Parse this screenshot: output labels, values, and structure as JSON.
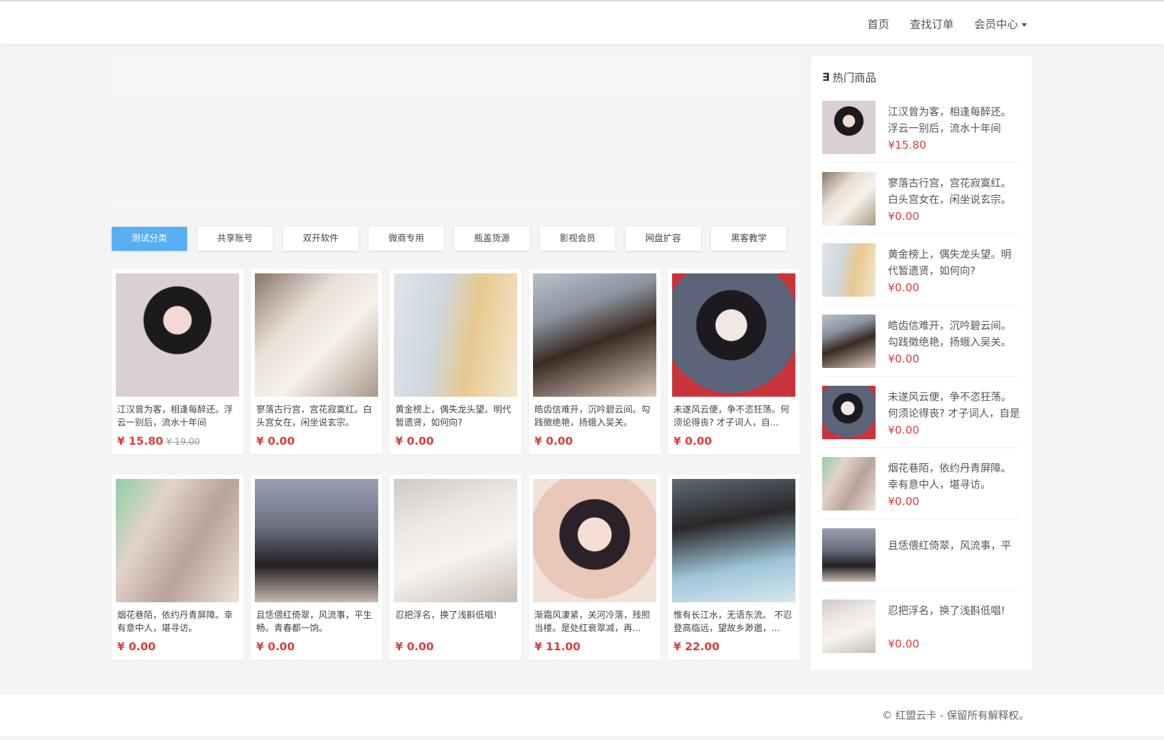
{
  "nav": {
    "home": "首页",
    "find_order": "查找订单",
    "member_center": "会员中心"
  },
  "categories": [
    "测试分类",
    "共享账号",
    "双开软件",
    "微商专用",
    "瓶盖货源",
    "影视会员",
    "网盘扩容",
    "黑客教学"
  ],
  "products": [
    {
      "title": "江汉曾为客，相逢每醉还。浮云一别后，流水十年间",
      "price": "¥ 15.80",
      "old_price": "¥ 19.00"
    },
    {
      "title": "寥落古行宫，宫花寂寞红。白头宫女在，闲坐说玄宗。",
      "price": "¥ 0.00",
      "old_price": ""
    },
    {
      "title": "黄金榜上，偶失龙头望。明代暂遗贤，如何向?",
      "price": "¥ 0.00",
      "old_price": ""
    },
    {
      "title": "皓齿信难开，沉吟碧云间。勾践徵绝艳，扬蛾入吴关。",
      "price": "¥ 0.00",
      "old_price": ""
    },
    {
      "title": "未遂风云便，争不恣狂荡。何须论得丧? 才子词人，自...",
      "price": "¥ 0.00",
      "old_price": ""
    },
    {
      "title": "烟花巷陌，依约丹青屏障。幸有意中人，堪寻访。",
      "price": "¥ 0.00",
      "old_price": ""
    },
    {
      "title": "且恁偎红倚翠，风流事，平生畅。青春都一饷。",
      "price": "¥ 0.00",
      "old_price": ""
    },
    {
      "title": "忍把浮名，换了浅斟低唱!",
      "price": "¥ 0.00",
      "old_price": ""
    },
    {
      "title": "渐霜风凄紧，关河冷落，残照当楼。是处红衰翠减，再...",
      "price": "¥ 11.00",
      "old_price": ""
    },
    {
      "title": "惟有长江水，无语东流。 不忍登高临远，望故乡渺邈，...",
      "price": "¥ 22.00",
      "old_price": ""
    }
  ],
  "sidebar": {
    "heading": "热门商品",
    "items": [
      {
        "title": "江汉曾为客，相逢每醉还。浮云一别后，流水十年间",
        "price": "¥15.80"
      },
      {
        "title": "寥落古行宫，宫花寂寞红。白头宫女在，闲坐说玄宗。",
        "price": "¥0.00"
      },
      {
        "title": "黄金榜上，偶失龙头望。明代暂遗贤，如何向?",
        "price": "¥0.00"
      },
      {
        "title": "皓齿信难开，沉吟碧云间。勾践徵绝艳，扬蛾入吴关。",
        "price": "¥0.00"
      },
      {
        "title": "未遂风云便，争不恣狂荡。何须论得丧? 才子词人，自是白",
        "price": "¥0.00"
      },
      {
        "title": "烟花巷陌，依约丹青屏障。幸有意中人，堪寻访。",
        "price": "¥0.00"
      },
      {
        "title": "且恁偎红倚翠，风流事，平",
        "price": ""
      },
      {
        "title": "忍把浮名，换了浅斟低唱!",
        "price": "¥0.00"
      }
    ]
  },
  "footer": {
    "copyright": "© 红盟云卡 - 保留所有解释权。"
  }
}
